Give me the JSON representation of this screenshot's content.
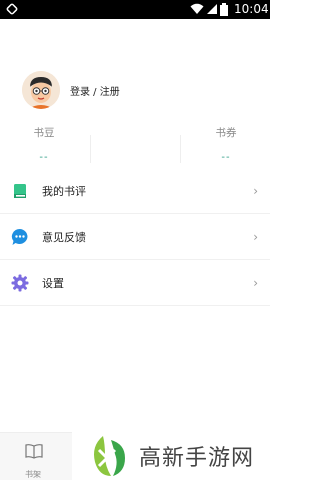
{
  "status_bar": {
    "time": "10:04",
    "icons": [
      "notification-icon",
      "wifi-icon",
      "signal-icon",
      "battery-icon"
    ]
  },
  "profile": {
    "login_label": "登录 / 注册",
    "avatar": "avatar-icon"
  },
  "stats": [
    {
      "label": "书豆",
      "value": "--"
    },
    {
      "label": "书券",
      "value": "--"
    }
  ],
  "menu": [
    {
      "label": "我的书评",
      "icon": "book-icon",
      "color": "#34c48a"
    },
    {
      "label": "意见反馈",
      "icon": "chat-bubble-icon",
      "color": "#1e8fe0"
    },
    {
      "label": "设置",
      "icon": "gear-icon",
      "color": "#7b6be0"
    }
  ],
  "tab_bar": {
    "items": [
      {
        "label": "书架",
        "icon": "bookshelf-icon"
      }
    ]
  },
  "watermark": {
    "text": "高新手游网"
  },
  "colors": {
    "accent": "#2e9e86",
    "chevron": "#999999"
  }
}
